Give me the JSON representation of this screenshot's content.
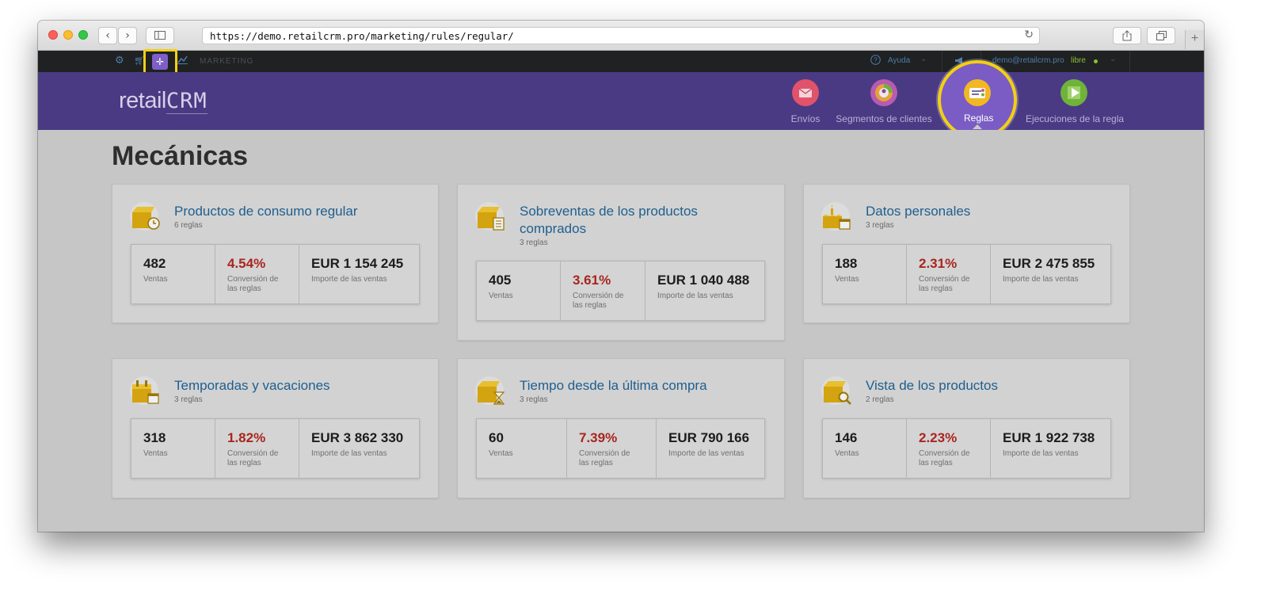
{
  "browser": {
    "url": "https://demo.retailcrm.pro/marketing/rules/regular/"
  },
  "topbar": {
    "section": "MARKETING",
    "help": "Ayuda",
    "email": "demo@retailcrm.pro",
    "plan": "libre"
  },
  "header": {
    "logo_main": "retail",
    "logo_crm": "CRM",
    "nav": [
      {
        "label": "Envíos",
        "color": "#e0536a"
      },
      {
        "label": "Segmentos de clientes",
        "color": "#b85bb0"
      },
      {
        "label": "Reglas",
        "color": "#f2b824"
      },
      {
        "label": "Ejecuciones de la regla",
        "color": "#6fb33a"
      }
    ]
  },
  "main": {
    "title": "Mecánicas",
    "stat_labels": {
      "sales": "Ventas",
      "conversion_1": "Conversión de",
      "conversion_2": "las reglas",
      "amount": "Importe de las ventas"
    },
    "cards": [
      {
        "title": "Productos de consumo regular",
        "rules": "6 reglas",
        "sales": "482",
        "conversion": "4.54%",
        "amount": "EUR 1 154 245",
        "icon": "box-clock-icon"
      },
      {
        "title": "Sobreventas de los productos",
        "title2": "comprados",
        "rules": "3 reglas",
        "sales": "405",
        "conversion": "3.61%",
        "amount": "EUR 1 040 488",
        "icon": "box-list-icon"
      },
      {
        "title": "Datos personales",
        "rules": "3 reglas",
        "sales": "188",
        "conversion": "2.31%",
        "amount": "EUR 2 475 855",
        "icon": "cake-calendar-icon"
      },
      {
        "title": "Temporadas y vacaciones",
        "rules": "3 reglas",
        "sales": "318",
        "conversion": "1.82%",
        "amount": "EUR 3 862 330",
        "icon": "calendar-icon"
      },
      {
        "title": "Tiempo desde la última compra",
        "rules": "3 reglas",
        "sales": "60",
        "conversion": "7.39%",
        "amount": "EUR 790 166",
        "icon": "box-hourglass-icon"
      },
      {
        "title": "Vista de los productos",
        "rules": "2 reglas",
        "sales": "146",
        "conversion": "2.23%",
        "amount": "EUR 1 922 738",
        "icon": "box-search-icon"
      }
    ]
  },
  "colors": {
    "header_purple": "#4a3a83",
    "accent_yellow": "#f3cf13",
    "link_blue": "#1e5f8f",
    "conversion_red": "#a8261f"
  }
}
